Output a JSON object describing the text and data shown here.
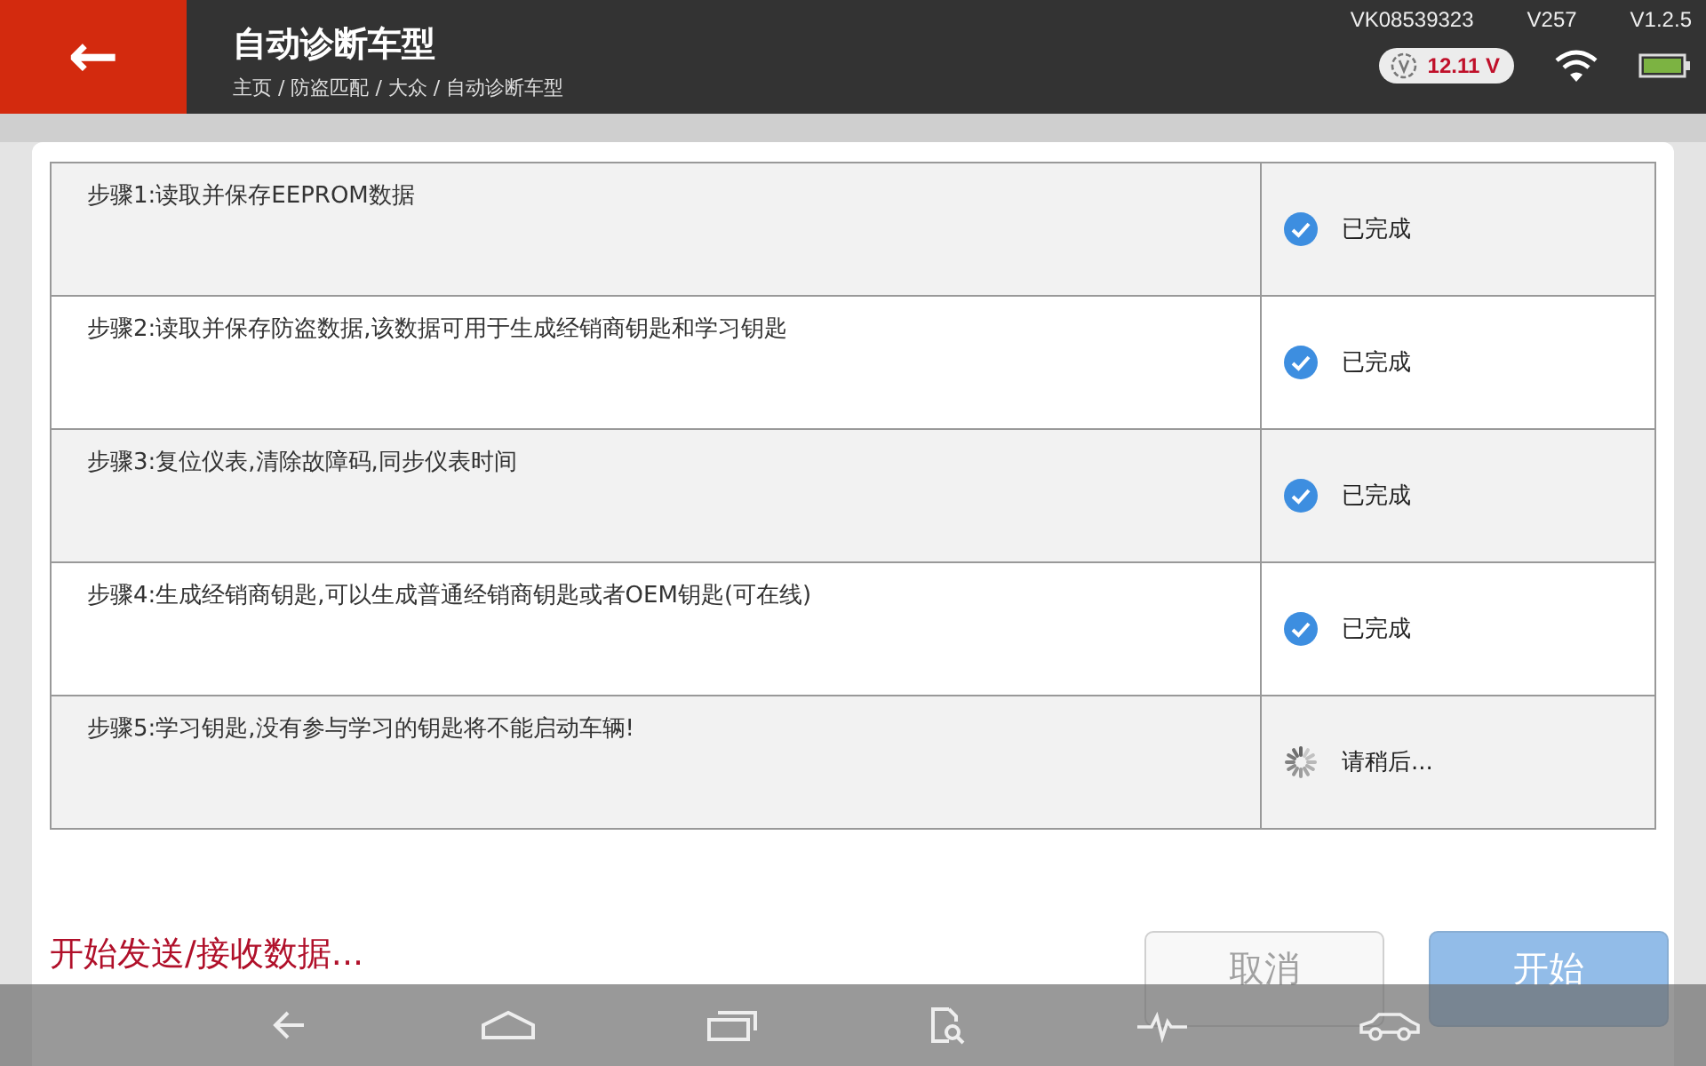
{
  "header": {
    "back": "←",
    "title": "自动诊断车型",
    "breadcrumb": "主页 / 防盗匹配 / 大众 / 自动诊断车型",
    "serial": "VK08539323",
    "version_a": "V257",
    "version_b": "V1.2.5",
    "voltage": "12.11 V"
  },
  "steps": [
    {
      "text": "步骤1:读取并保存EEPROM数据",
      "status": "已完成",
      "kind": "done"
    },
    {
      "text": "步骤2:读取并保存防盗数据,该数据可用于生成经销商钥匙和学习钥匙",
      "status": "已完成",
      "kind": "done"
    },
    {
      "text": "步骤3:复位仪表,清除故障码,同步仪表时间",
      "status": "已完成",
      "kind": "done"
    },
    {
      "text": "步骤4:生成经销商钥匙,可以生成普通经销商钥匙或者OEM钥匙(可在线)",
      "status": "已完成",
      "kind": "done"
    },
    {
      "text": "步骤5:学习钥匙,没有参与学习的钥匙将不能启动车辆!",
      "status": "请稍后...",
      "kind": "waiting"
    }
  ],
  "message": "开始发送/接收数据...",
  "buttons": [
    {
      "label": "取消",
      "kind": "cancel",
      "disabled": true
    },
    {
      "label": "开始",
      "kind": "start",
      "disabled": true
    }
  ]
}
